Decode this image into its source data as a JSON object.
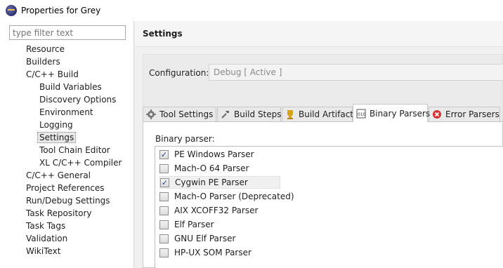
{
  "window": {
    "title": "Properties for Grey"
  },
  "filter": {
    "placeholder": "type filter text"
  },
  "tree": [
    {
      "label": "Resource",
      "level": 0
    },
    {
      "label": "Builders",
      "level": 0
    },
    {
      "label": "C/C++ Build",
      "level": 0
    },
    {
      "label": "Build Variables",
      "level": 1
    },
    {
      "label": "Discovery Options",
      "level": 1
    },
    {
      "label": "Environment",
      "level": 1
    },
    {
      "label": "Logging",
      "level": 1
    },
    {
      "label": "Settings",
      "level": 1,
      "selected": true
    },
    {
      "label": "Tool Chain Editor",
      "level": 1
    },
    {
      "label": "XL C/C++ Compiler",
      "level": 1
    },
    {
      "label": "C/C++ General",
      "level": 0
    },
    {
      "label": "Project References",
      "level": 0
    },
    {
      "label": "Run/Debug Settings",
      "level": 0
    },
    {
      "label": "Task Repository",
      "level": 0
    },
    {
      "label": "Task Tags",
      "level": 0
    },
    {
      "label": "Validation",
      "level": 0
    },
    {
      "label": "WikiText",
      "level": 0
    }
  ],
  "page": {
    "title": "Settings"
  },
  "configuration": {
    "label": "Configuration:",
    "value": "Debug  [ Active ]"
  },
  "tabs": [
    {
      "label": "Tool Settings",
      "icon": "tool-settings-icon"
    },
    {
      "label": "Build Steps",
      "icon": "build-steps-icon"
    },
    {
      "label": "Build Artifact",
      "icon": "build-artifact-icon"
    },
    {
      "label": "Binary Parsers",
      "icon": "binary-parsers-icon",
      "active": true
    },
    {
      "label": "Error Parsers",
      "icon": "error-parsers-icon"
    }
  ],
  "binary_parsers": {
    "label": "Binary parser:",
    "items": [
      {
        "label": "PE Windows Parser",
        "checked": true
      },
      {
        "label": "Mach-O 64 Parser",
        "checked": false
      },
      {
        "label": "Cygwin PE Parser",
        "checked": true,
        "highlighted": true
      },
      {
        "label": "Mach-O Parser (Deprecated)",
        "checked": false
      },
      {
        "label": "AIX XCOFF32 Parser",
        "checked": false
      },
      {
        "label": "Elf Parser",
        "checked": false
      },
      {
        "label": "GNU Elf Parser",
        "checked": false
      },
      {
        "label": "HP-UX SOM Parser",
        "checked": false
      }
    ]
  }
}
